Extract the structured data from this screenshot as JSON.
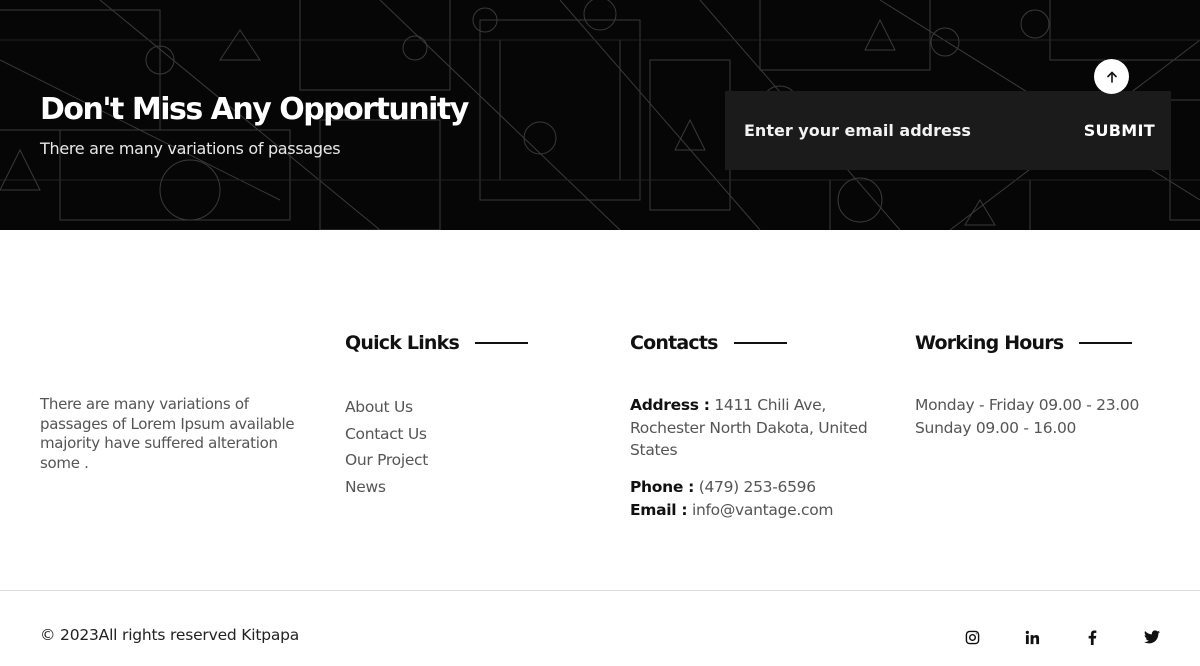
{
  "newsletter": {
    "title": "Don't Miss Any Opportunity",
    "subtitle": "There are many variations of passages",
    "email_placeholder": "Enter your email address",
    "submit_label": "SUBMIT"
  },
  "footer": {
    "about_text": "There are many variations of passages of Lorem Ipsum available majority have suffered alteration some .",
    "quick_links": {
      "heading": "Quick Links",
      "items": [
        "About Us",
        "Contact Us",
        "Our Project",
        "News"
      ]
    },
    "contacts": {
      "heading": "Contacts",
      "address_label": "Address :",
      "address_value": "1411 Chili Ave, Rochester North Dakota, United States",
      "phone_label": "Phone :",
      "phone_value": "(479) 253-6596",
      "email_label": "Email :",
      "email_value": "info@vantage.com"
    },
    "working_hours": {
      "heading": "Working Hours",
      "lines": [
        "Monday - Friday 09.00 - 23.00",
        "Sunday 09.00 - 16.00"
      ]
    },
    "copyright": "© 2023All rights reserved Kitpapa",
    "social_icons": [
      "instagram-icon",
      "linkedin-icon",
      "facebook-icon",
      "twitter-icon"
    ]
  }
}
